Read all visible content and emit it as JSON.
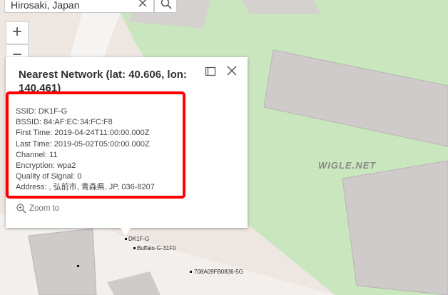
{
  "search": {
    "value": "Hirosaki, Japan"
  },
  "map_controls": {
    "zoom_in_symbol": "+",
    "zoom_out_symbol": "−"
  },
  "popup": {
    "title": "Nearest Network (lat: 40.606, lon: 140.461)",
    "details": [
      "SSID: DK1F-G",
      "BSSID: 84:AF:EC:34:FC:F8",
      "First Time: 2019-04-24T11:00:00.000Z",
      "Last Time: 2019-05-02T05:00:00.000Z",
      "Channel: 11",
      "Encryption: wpa2",
      "Quality of Signal: 0",
      "Address: , 弘前市, 青森県, JP, 036-8207"
    ],
    "zoom_to_label": "Zoom to"
  },
  "map_labels": [
    "DK1F-G",
    "Buffalo-G-31F0",
    "708A09FB0836-5G"
  ],
  "watermark": "WIGLE.NET",
  "colors": {
    "highlight": "#ff0000",
    "park": "#c8e6bd",
    "building": "#d0cccb",
    "road": "#f6f3f1"
  }
}
